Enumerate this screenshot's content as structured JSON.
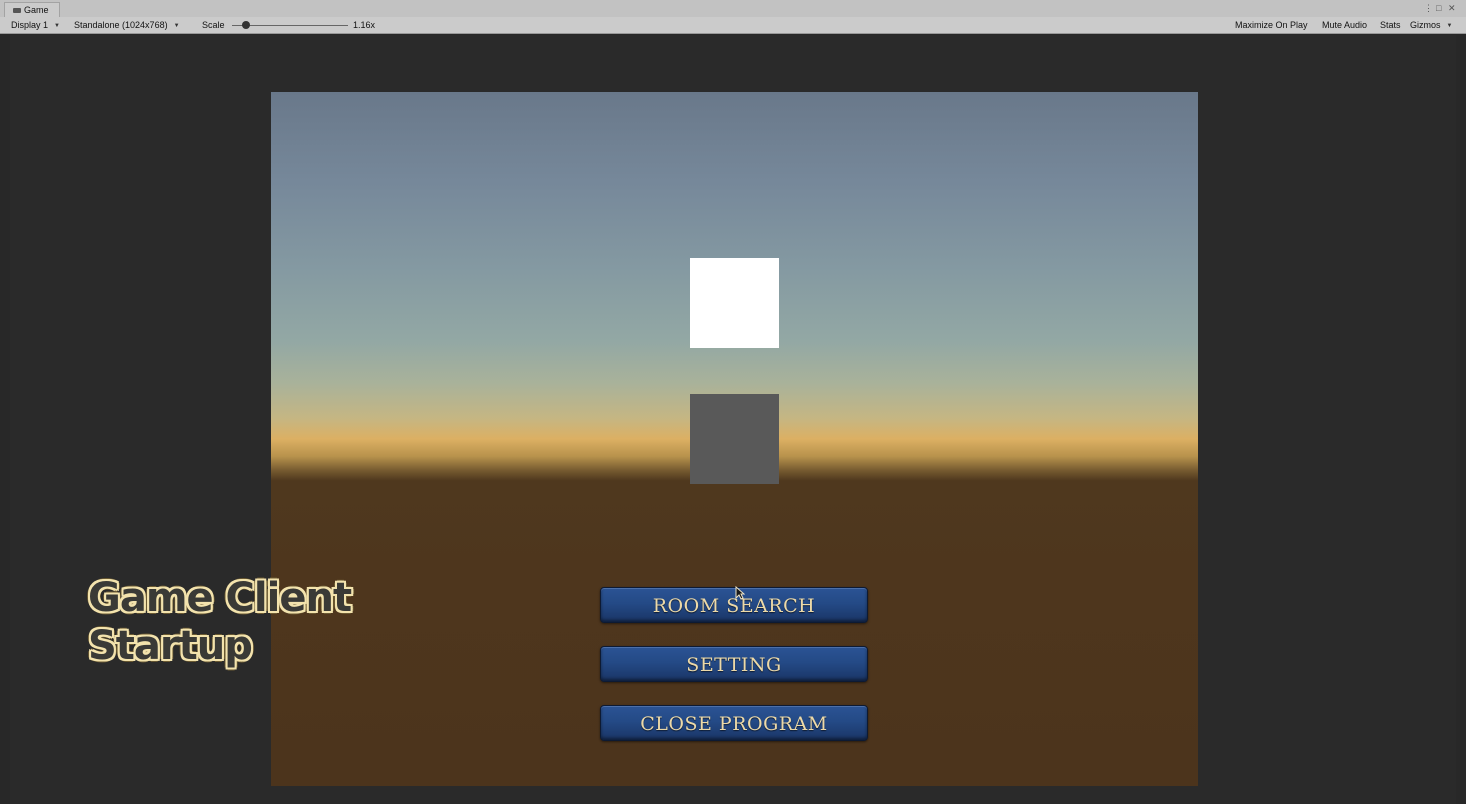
{
  "window": {
    "tab_label": "Game",
    "tab_icon": "gamepad-icon",
    "controls": [
      "menu-icon",
      "maximize-icon",
      "close-icon"
    ]
  },
  "toolbar": {
    "display": "Display 1",
    "resolution": "Standalone (1024x768)",
    "scale_label": "Scale",
    "scale_value": "1.16x",
    "scale_fraction": 0.1,
    "maximize_on_play": "Maximize On Play",
    "mute_audio": "Mute Audio",
    "stats": "Stats",
    "gizmos": "Gizmos"
  },
  "scene": {
    "sky_colors": [
      "#69788a",
      "#93a8a4",
      "#dcb063"
    ],
    "ground_color": "#4e361d",
    "objects": [
      "white-square",
      "grey-square"
    ]
  },
  "menu": {
    "room_search": "ROOM SEARCH",
    "setting": "SETTING",
    "close_program": "CLOSE PROGRAM",
    "button_color": "#244a86",
    "text_color": "#ecd9a8"
  },
  "caption": {
    "line1": "Game Client",
    "line2": "Startup"
  }
}
